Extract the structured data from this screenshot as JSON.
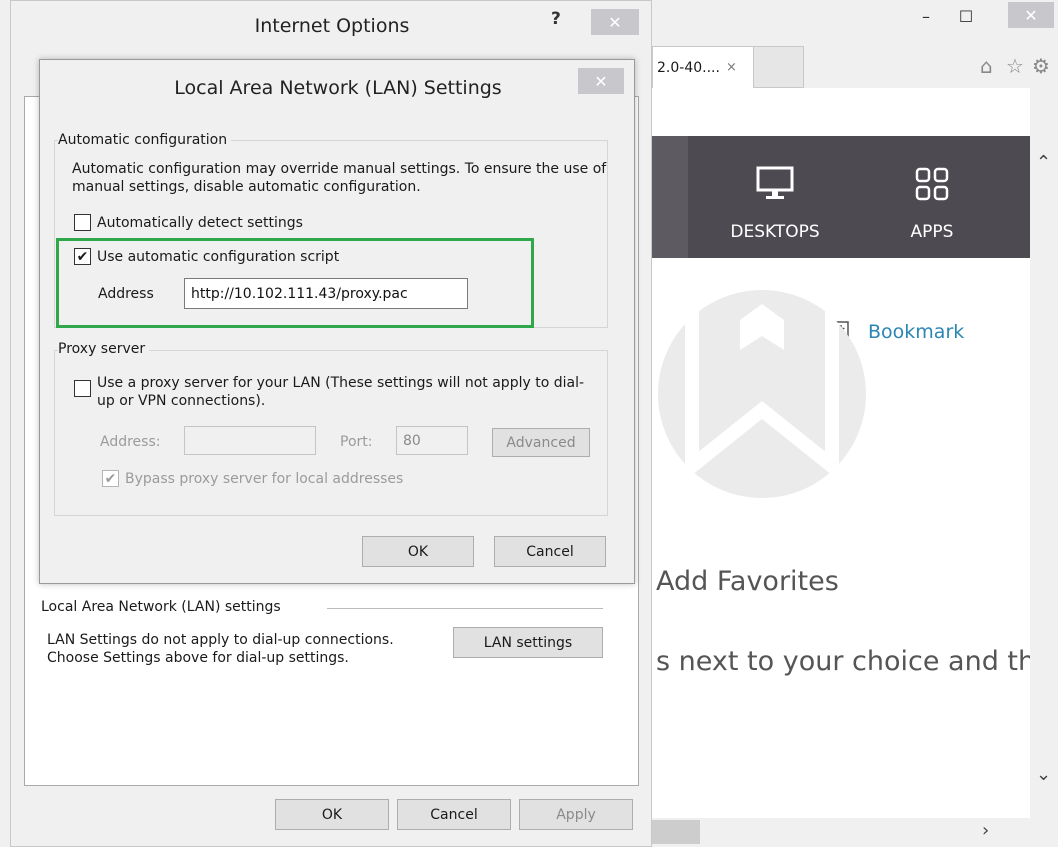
{
  "browser": {
    "tab_label": "2.0-40....",
    "tab_close": "×",
    "window_controls": {
      "minimize": "–",
      "maximize": "☐",
      "close": "✕"
    },
    "toolbar_icons": [
      "home-icon",
      "star-icon",
      "gear-icon"
    ],
    "nav": [
      {
        "label": "DESKTOPS",
        "icon": "monitor-icon"
      },
      {
        "label": "APPS",
        "icon": "grid-icon"
      }
    ],
    "bookmark_label": "Bookmark",
    "add_favorites": "Add Favorites",
    "favorites_hint": "s next to your choice and the",
    "accent_color": "#2b86b5",
    "topbar_color": "#4e4a52"
  },
  "internet_options": {
    "title": "Internet Options",
    "help": "?",
    "lan_group_title": "Local Area Network (LAN) settings",
    "lan_desc": "LAN Settings do not apply to dial-up connections. Choose Settings above for dial-up settings.",
    "lan_settings_button": "LAN settings",
    "ok": "OK",
    "cancel": "Cancel",
    "apply": "Apply"
  },
  "lan_dialog": {
    "title": "Local Area Network (LAN) Settings",
    "auto_config": {
      "title": "Automatic configuration",
      "description": "Automatic configuration may override manual settings.  To ensure the use of manual settings, disable automatic configuration.",
      "auto_detect_label": "Automatically detect settings",
      "auto_detect_checked": false,
      "use_script_label": "Use automatic configuration script",
      "use_script_checked": true,
      "address_label": "Address",
      "address_value": "http://10.102.111.43/proxy.pac",
      "highlight_color": "#2ea84a"
    },
    "proxy": {
      "title": "Proxy server",
      "use_proxy_label": "Use a proxy server for your LAN (These settings will not apply to dial-up or VPN connections).",
      "use_proxy_checked": false,
      "address_label": "Address:",
      "address_value": "",
      "port_label": "Port:",
      "port_value": "80",
      "advanced": "Advanced",
      "bypass_label": "Bypass proxy server for local addresses",
      "bypass_checked": true
    },
    "ok": "OK",
    "cancel": "Cancel"
  }
}
